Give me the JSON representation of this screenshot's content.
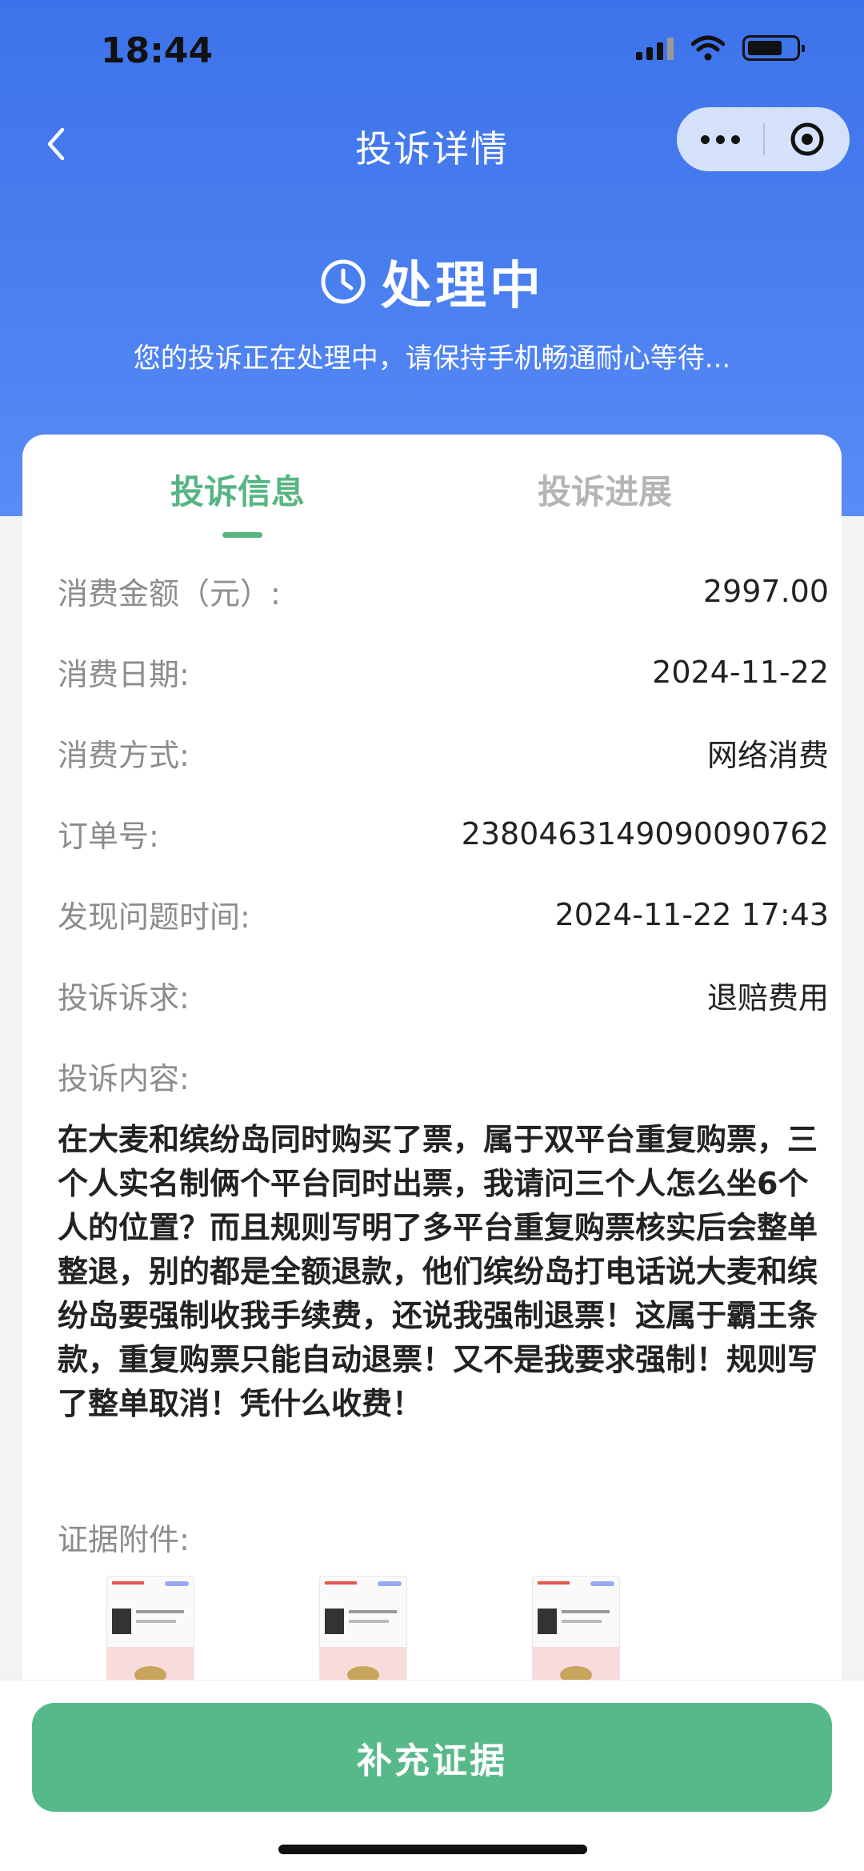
{
  "status_bar": {
    "time": "18:44"
  },
  "nav": {
    "title": "投诉详情"
  },
  "status": {
    "title": "处理中",
    "subtitle": "您的投诉正在处理中，请保持手机畅通耐心等待..."
  },
  "tabs": [
    {
      "label": "投诉信息",
      "active": true
    },
    {
      "label": "投诉进展",
      "active": false
    }
  ],
  "details": [
    {
      "label": "消费金额（元）:",
      "value": "2997.00"
    },
    {
      "label": "消费日期:",
      "value": "2024-11-22"
    },
    {
      "label": "消费方式:",
      "value": "网络消费"
    },
    {
      "label": "订单号:",
      "value": "23804631490900907​62"
    },
    {
      "label": "发现问题时间:",
      "value": "2024-11-22 17:43"
    },
    {
      "label": "投诉诉求:",
      "value": "退赔费用"
    }
  ],
  "content": {
    "label": "投诉内容:",
    "text": "在大麦和缤纷岛同时购买了票，属于双平台重复购票，三个人实名制俩个平台同时出票，我请问三个人怎么坐6个人的位置？而且规则写明了多平台重复购票核实后会整单整退，别的都是全额退款，他们缤纷岛打电话说大麦和缤纷岛要强制收我手续费，还说我强制退票！这属于霸王条款，重复购票只能自动退票！又不是我要求强制！规则写了整单取消！凭什么收费！"
  },
  "attachments": {
    "label": "证据附件:",
    "count": 3
  },
  "bottom": {
    "button_label": "补充证据"
  },
  "colors": {
    "accent_green": "#57b583",
    "hero_blue": "#4a7ff0",
    "button_green": "#57b98a"
  }
}
